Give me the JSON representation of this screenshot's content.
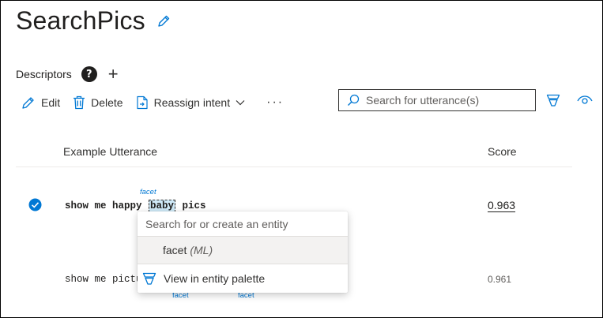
{
  "app": {
    "title": "SearchPics"
  },
  "descriptors": {
    "label": "Descriptors",
    "help": "?",
    "add": "+"
  },
  "toolbar": {
    "edit_label": "Edit",
    "delete_label": "Delete",
    "reassign_label": "Reassign intent",
    "more_label": "···"
  },
  "search": {
    "placeholder": "Search for utterance(s)",
    "value": ""
  },
  "table": {
    "columns": [
      "Example Utterance",
      "Score"
    ],
    "rows": [
      {
        "selected": true,
        "tokens": [
          "show me happy ",
          "baby",
          " pics"
        ],
        "entity": "facet",
        "score": "0.963"
      },
      {
        "selected": false,
        "text": "show me pictur",
        "entities": [
          "facet",
          "facet"
        ],
        "score": "0.961"
      }
    ]
  },
  "entity_dropdown": {
    "placeholder": "Search for or create an entity",
    "items": [
      {
        "name": "facet",
        "type": "(ML)"
      }
    ],
    "footer": "View in entity palette"
  },
  "colors": {
    "accent": "#0078d4",
    "highlight": "#cfe9f7",
    "text": "#323130"
  },
  "icons": [
    "pencil-icon",
    "edit-icon",
    "trash-icon",
    "reassign-icon",
    "chevron-down-icon",
    "search-icon",
    "filter-icon",
    "eye-icon",
    "check-circle-icon",
    "entity-palette-icon"
  ]
}
